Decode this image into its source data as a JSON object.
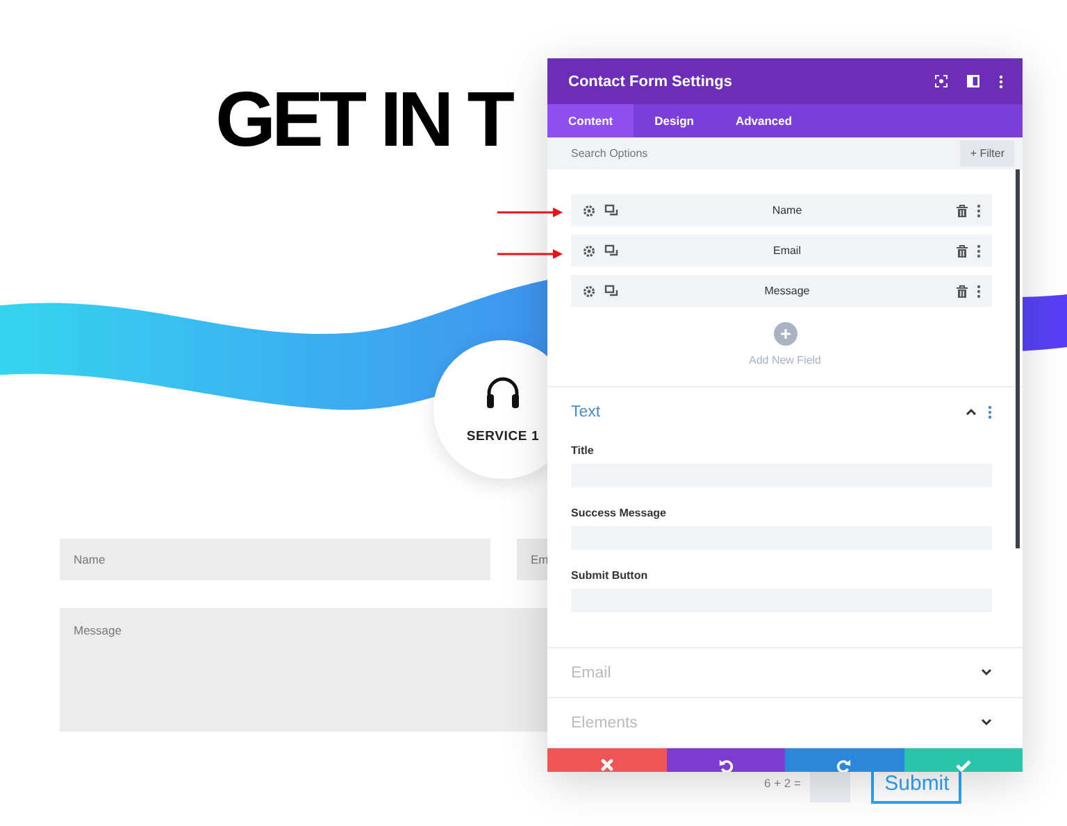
{
  "page": {
    "heading": "GET IN T",
    "service": {
      "label": "SERVICE 1"
    },
    "form": {
      "name_placeholder": "Name",
      "email_placeholder": "Em",
      "message_placeholder": "Message",
      "captcha": "6 + 2 =",
      "submit": "Submit"
    }
  },
  "panel": {
    "title": "Contact Form Settings",
    "tabs": [
      {
        "label": "Content",
        "selected": true
      },
      {
        "label": "Design",
        "selected": false
      },
      {
        "label": "Advanced",
        "selected": false
      }
    ],
    "search": {
      "placeholder": "Search Options"
    },
    "filter_button": "+ Filter",
    "fields": [
      {
        "label": "Name",
        "marked": true
      },
      {
        "label": "Email",
        "marked": true
      },
      {
        "label": "Message",
        "marked": false
      }
    ],
    "add_field": "Add New Field",
    "sections": [
      {
        "title": "Text",
        "expanded": true,
        "options": [
          {
            "label": "Title"
          },
          {
            "label": "Success Message"
          },
          {
            "label": "Submit Button"
          }
        ]
      },
      {
        "title": "Email",
        "expanded": false
      },
      {
        "title": "Elements",
        "expanded": false
      }
    ],
    "footer": [
      {
        "kind": "discard"
      },
      {
        "kind": "undo"
      },
      {
        "kind": "redo"
      },
      {
        "kind": "save"
      }
    ]
  }
}
